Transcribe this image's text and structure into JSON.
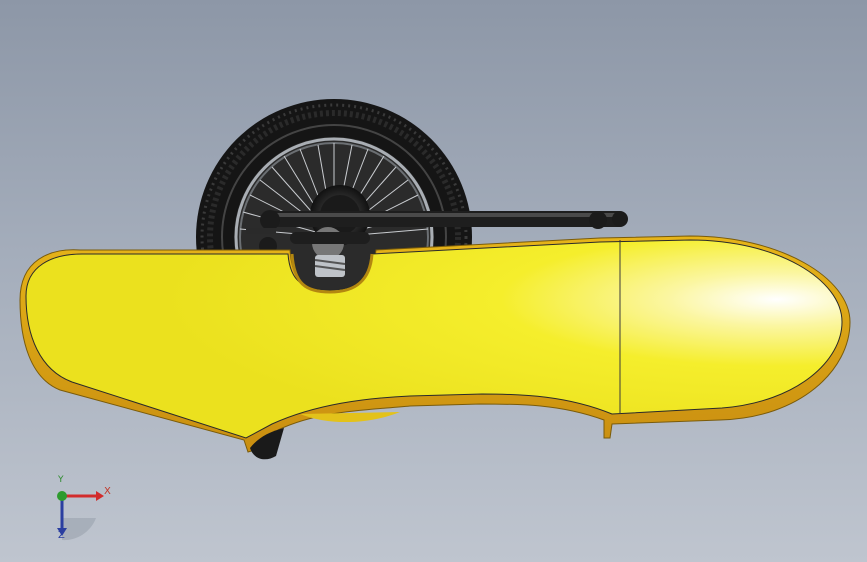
{
  "viewport": {
    "background_top": "#8d97a7",
    "background_bottom": "#bfc5cf"
  },
  "model": {
    "body_color": "#f5ef2a",
    "body_edge_color": "#c99a12",
    "tire_color": "#1c1c1c",
    "rim_color": "#9aa0a6",
    "frame_color": "#202020"
  },
  "triad": {
    "x_label": "X",
    "y_label": "Y",
    "z_label": "Z",
    "x_color": "#d22c2c",
    "y_color": "#2e9b2e",
    "z_color": "#2b3fa0"
  }
}
